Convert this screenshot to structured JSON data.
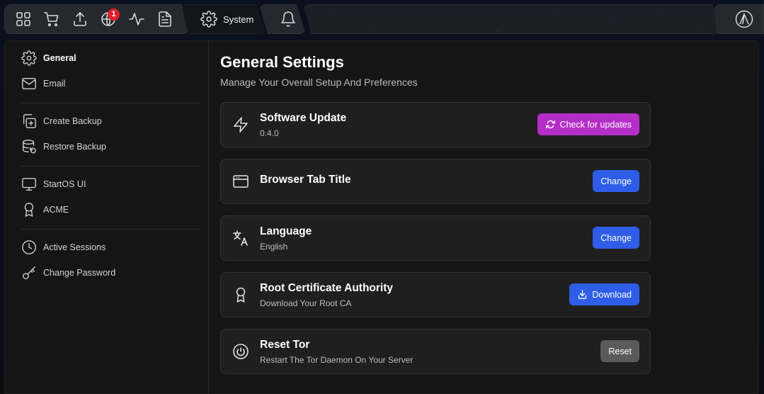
{
  "colors": {
    "purple_button": "#b52ec7",
    "blue_button": "#2f5de8",
    "gray_button": "#5a5a5a",
    "badge": "#e0202a"
  },
  "topbar": {
    "icons": [
      "grid-icon",
      "cart-icon",
      "upload-icon",
      "globe-icon",
      "activity-icon",
      "document-icon"
    ],
    "notification_count": "1",
    "system_tab_label": "System",
    "bell_icon": "bell-icon",
    "logo_icon": "startos-logo-icon"
  },
  "sidebar": {
    "items": [
      {
        "label": "General",
        "icon": "gear-icon"
      },
      {
        "label": "Email",
        "icon": "mail-icon"
      },
      {
        "label": "Create Backup",
        "icon": "copy-plus-icon"
      },
      {
        "label": "Restore Backup",
        "icon": "database-restore-icon"
      },
      {
        "label": "StartOS UI",
        "icon": "monitor-icon"
      },
      {
        "label": "ACME",
        "icon": "award-icon"
      },
      {
        "label": "Active Sessions",
        "icon": "clock-icon"
      },
      {
        "label": "Change Password",
        "icon": "key-icon"
      }
    ]
  },
  "main": {
    "title": "General Settings",
    "subtitle": "Manage Your Overall Setup And Preferences",
    "cards": [
      {
        "title": "Software Update",
        "subtitle": "0.4.0",
        "button": "Check for updates",
        "icon": "zap-icon"
      },
      {
        "title": "Browser Tab Title",
        "subtitle": "",
        "button": "Change",
        "icon": "browser-window-icon"
      },
      {
        "title": "Language",
        "subtitle": "English",
        "button": "Change",
        "icon": "translate-icon"
      },
      {
        "title": "Root Certificate Authority",
        "subtitle": "Download Your Root CA",
        "button": "Download",
        "icon": "certificate-icon"
      },
      {
        "title": "Reset Tor",
        "subtitle": "Restart The Tor Daemon On Your Server",
        "button": "Reset",
        "icon": "power-icon"
      }
    ]
  }
}
